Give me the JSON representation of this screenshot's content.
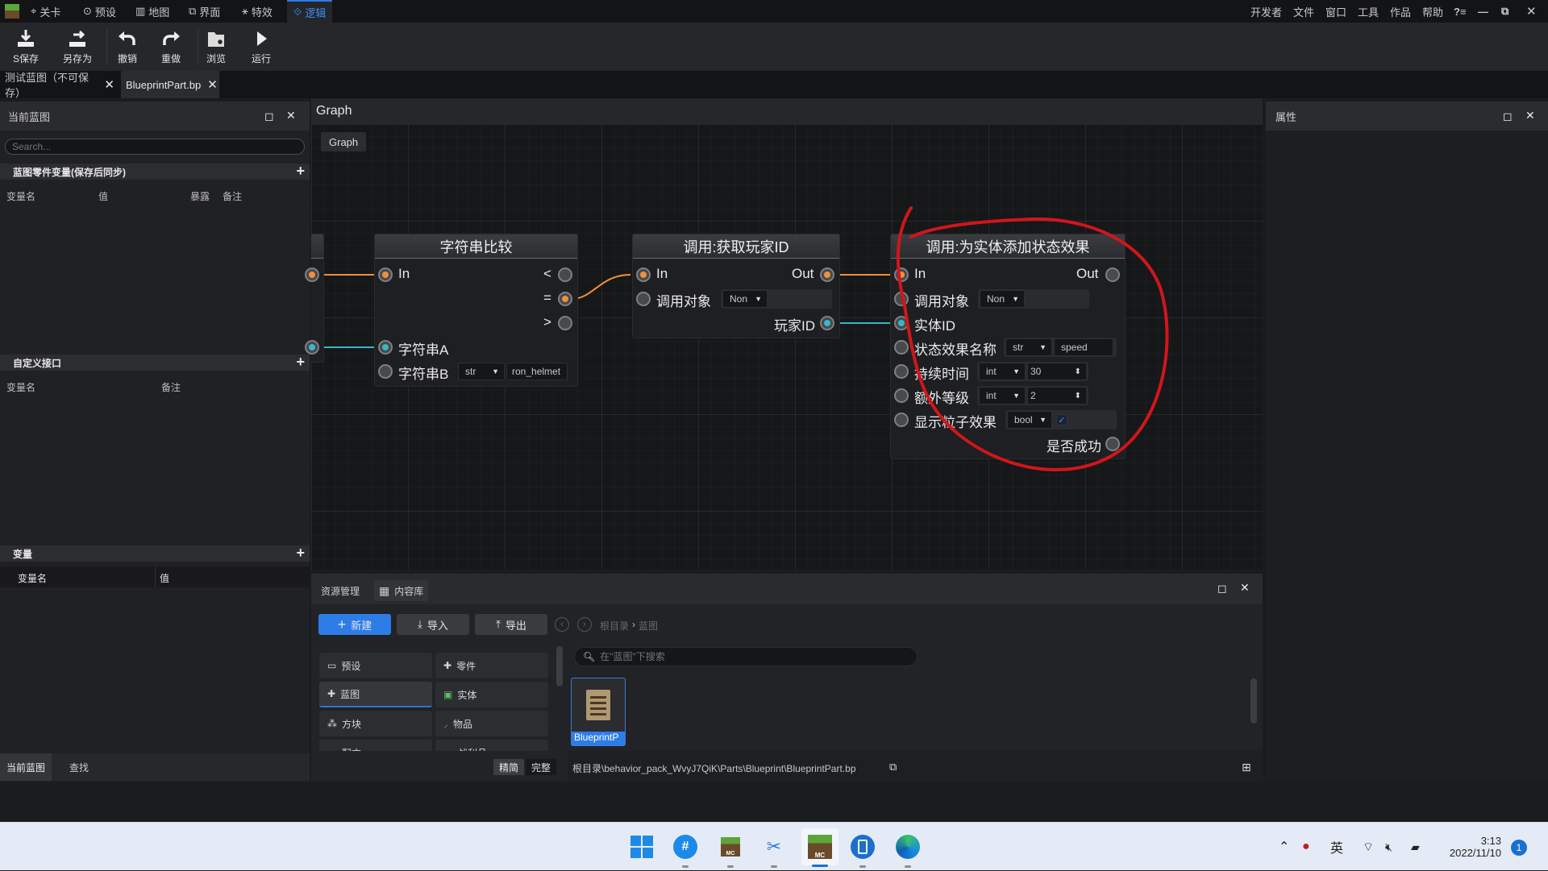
{
  "menubar": {
    "logo": "minecraft-logo",
    "items": [
      {
        "label": "关卡",
        "icon": "target-icon"
      },
      {
        "label": "预设",
        "icon": "preset-icon"
      },
      {
        "label": "地图",
        "icon": "map-icon"
      },
      {
        "label": "界面",
        "icon": "window-icon"
      },
      {
        "label": "特效",
        "icon": "effects-icon"
      },
      {
        "label": "逻辑",
        "icon": "logic-icon",
        "active": true
      }
    ],
    "right_items": [
      "开发者",
      "文件",
      "窗口",
      "工具",
      "作品",
      "帮助"
    ],
    "help_icon": "?≡"
  },
  "toolbar": {
    "buttons": [
      {
        "label": "S保存",
        "icon": "save-icon"
      },
      {
        "label": "另存为",
        "icon": "save-as-icon"
      },
      {
        "label": "撤销",
        "icon": "undo-icon"
      },
      {
        "label": "重做",
        "icon": "redo-icon"
      },
      {
        "label": "浏览",
        "icon": "browse-icon"
      },
      {
        "label": "运行",
        "icon": "run-icon"
      }
    ]
  },
  "file_tabs": [
    {
      "label": "测试蓝图（不可保存）",
      "active": false
    },
    {
      "label": "BlueprintPart.bp",
      "active": true
    }
  ],
  "left_panel": {
    "title": "当前蓝图",
    "search_placeholder": "Search...",
    "sections": [
      {
        "title": "蓝图零件变量(保存后同步)",
        "columns": [
          "变量名",
          "值",
          "暴露",
          "备注"
        ]
      },
      {
        "title": "自定义接口",
        "columns": [
          "变量名",
          "备注"
        ]
      },
      {
        "title": "变量",
        "columns": [
          "变量名",
          "值"
        ]
      }
    ],
    "bottom_tabs": [
      "当前蓝图",
      "查找"
    ]
  },
  "graph": {
    "title": "Graph",
    "breadcrumb": "Graph",
    "nodes": [
      {
        "title": "字符串比较",
        "inputs": [
          "In",
          "字符串A",
          "字符串B"
        ],
        "outputs": [
          "<",
          "=",
          ">"
        ],
        "field_b": {
          "type": "str",
          "value": "ron_helmet"
        }
      },
      {
        "title": "调用:获取玩家ID",
        "inputs": [
          "In",
          "调用对象"
        ],
        "outputs": [
          "Out",
          "玩家ID"
        ],
        "target": {
          "type": "Non"
        }
      },
      {
        "title": "调用:为实体添加状态效果",
        "inputs": [
          "In",
          "调用对象",
          "实体ID",
          "状态效果名称",
          "持续时间",
          "额外等级",
          "显示粒子效果"
        ],
        "outputs": [
          "Out",
          "是否成功"
        ],
        "target": {
          "type": "Non"
        },
        "effect_name": {
          "type": "str",
          "value": "speed"
        },
        "duration": {
          "type": "int",
          "value": "30"
        },
        "amplifier": {
          "type": "int",
          "value": "2"
        },
        "show_particles": {
          "type": "bool",
          "checked": true
        }
      }
    ],
    "colors": {
      "exec": "#f0903a",
      "data": "#35b8c8",
      "annotation": "#d0161b"
    }
  },
  "properties_panel": {
    "title": "属性"
  },
  "resource_panel": {
    "tabs": [
      "资源管理",
      "内容库"
    ],
    "buttons": {
      "new": "新建",
      "import": "导入",
      "export": "导出"
    },
    "breadcrumb": [
      "根目录",
      "蓝图"
    ],
    "categories": [
      {
        "label": "预设",
        "icon": "preset-icon"
      },
      {
        "label": "零件",
        "icon": "part-icon"
      },
      {
        "label": "蓝图",
        "icon": "blueprint-icon",
        "selected": true
      },
      {
        "label": "实体",
        "icon": "entity-icon"
      },
      {
        "label": "方块",
        "icon": "block-icon"
      },
      {
        "label": "物品",
        "icon": "item-icon"
      },
      {
        "label": "配方",
        "icon": "folder-icon"
      },
      {
        "label": "战利品",
        "icon": "folder-icon"
      }
    ],
    "view_modes": [
      "精简",
      "完整"
    ],
    "search_placeholder": "在\"蓝图\"下搜索",
    "files": [
      {
        "name": "BlueprintP"
      }
    ],
    "path": "根目录\\behavior_pack_WvyJ7QiK\\Parts\\Blueprint\\BlueprintPart.bp"
  },
  "taskbar": {
    "apps": [
      "start-icon",
      "hashtag-app-icon",
      "minecraft-editor-icon",
      "snipping-tool-icon",
      "minecraft-icon",
      "phone-link-icon",
      "edge-icon"
    ],
    "tray": {
      "ime": "英",
      "time": "3:13",
      "date": "2022/11/10",
      "notifications": "1"
    }
  }
}
